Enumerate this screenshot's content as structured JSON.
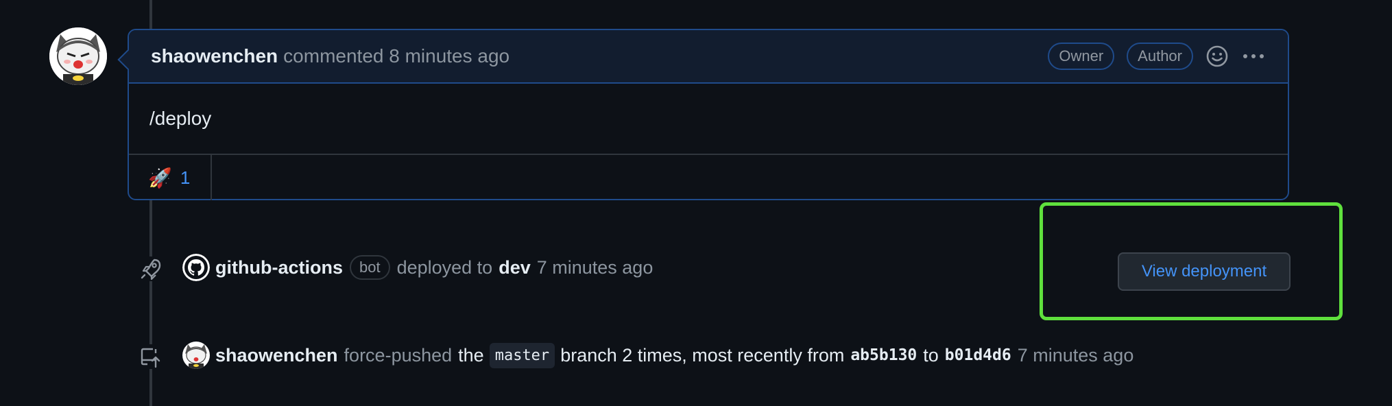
{
  "comment": {
    "author": "shaowenchen",
    "meta": "commented 8 minutes ago",
    "badges": [
      "Owner",
      "Author"
    ],
    "body": "/deploy",
    "reaction": {
      "emoji": "🚀",
      "count": "1"
    },
    "icons": {
      "reaction_picker": "smiley-icon",
      "more": "kebab-horizontal-icon"
    }
  },
  "deploy_event": {
    "icon": "rocket-icon",
    "actor": "github-actions",
    "badge": "bot",
    "action": "deployed to",
    "environment": "dev",
    "time": "7 minutes ago",
    "button_label": "View deployment"
  },
  "push_event": {
    "icon": "repo-push-icon",
    "actor": "shaowenchen",
    "action": "force-pushed",
    "the": "the",
    "branch": "master",
    "branch_suffix": "branch 2 times, most recently from",
    "from_sha": "ab5b130",
    "to": "to",
    "to_sha": "b01d4d6",
    "time": "7 minutes ago"
  },
  "colors": {
    "background": "#0d1117",
    "accent_blue": "#4493f8",
    "header_bg": "#121d2f",
    "highlight_green": "#5fe03d"
  }
}
